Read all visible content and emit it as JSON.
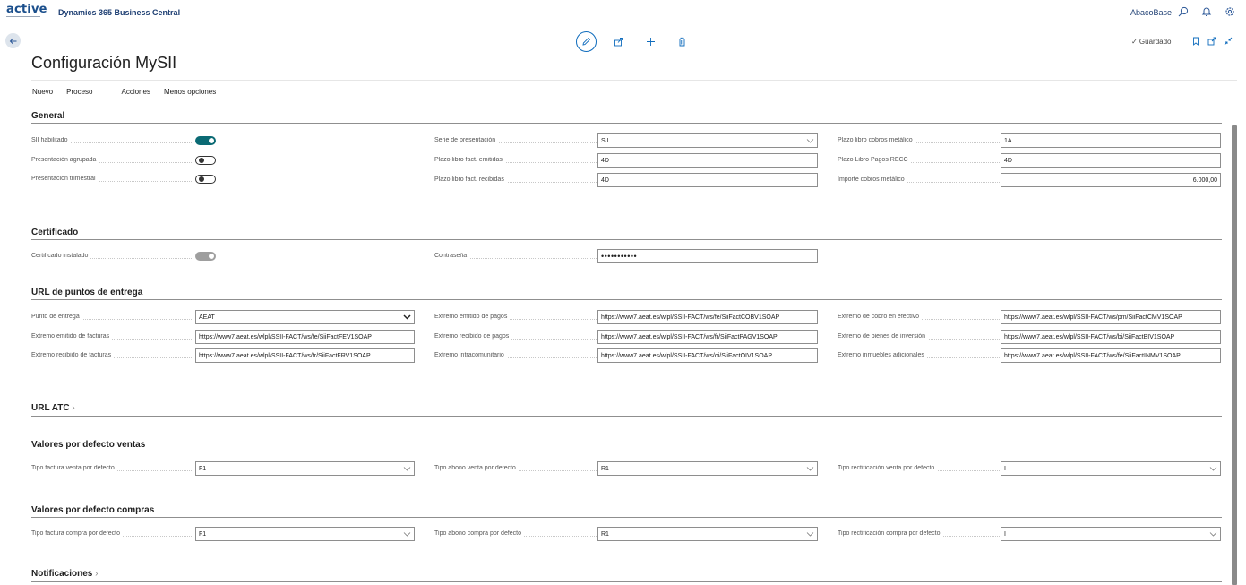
{
  "app": {
    "logo": "active",
    "product": "Dynamics 365 Business Central",
    "company": "AbacoBase"
  },
  "header": {
    "saved_label": "✓ Guardado",
    "title": "Configuración MySII"
  },
  "menu": {
    "items": [
      "Nuevo",
      "Proceso",
      "Acciones",
      "Menos opciones"
    ]
  },
  "sections": {
    "general": "General",
    "certificado": "Certificado",
    "url_puntos": "URL de puntos de entrega",
    "url_atc": "URL ATC",
    "defecto_ventas": "Valores por defecto ventas",
    "defecto_compras": "Valores por defecto compras",
    "notificaciones": "Notificaciones"
  },
  "general": {
    "sii_habilitado": {
      "label": "SII habilitado",
      "on": true
    },
    "presentacion_agrupada": {
      "label": "Presentación agrupada",
      "on": false
    },
    "presentacion_trimestral": {
      "label": "Presentacion trimestral",
      "on": false
    },
    "serie_presentacion": {
      "label": "Serie de presentación",
      "value": "SII"
    },
    "plazo_emitidas": {
      "label": "Plazo libro fact. emitidas",
      "value": "4D"
    },
    "plazo_recibidas": {
      "label": "Plazo libro fact. recibidas",
      "value": "4D"
    },
    "plazo_cobros_metalico": {
      "label": "Plazo libro cobros metálico",
      "value": "1A"
    },
    "plazo_pagos_recc": {
      "label": "Plazo Libro Pagos RECC",
      "value": "4D"
    },
    "importe_cobros_metalico": {
      "label": "Importe cobros metálico",
      "value": "6.000,00"
    }
  },
  "certificado": {
    "instalado": {
      "label": "Certificado instalado",
      "on": true
    },
    "contrasena": {
      "label": "Contraseña",
      "value": "•••••••••••"
    }
  },
  "urls": {
    "punto_entrega": {
      "label": "Punto de entrega",
      "value": "AEAT"
    },
    "emitido_facturas": {
      "label": "Extremo emitido de facturas",
      "value": "https://www7.aeat.es/wlpl/SSII-FACT/ws/fe/SiiFactFEV1SOAP"
    },
    "recibido_facturas": {
      "label": "Extremo recibido de facturas",
      "value": "https://www7.aeat.es/wlpl/SSII-FACT/ws/fr/SiiFactFRV1SOAP"
    },
    "emitido_pagos": {
      "label": "Extremo emitido de pagos",
      "value": "https://www7.aeat.es/wlpl/SSII-FACT/ws/fe/SiiFactCOBV1SOAP"
    },
    "recibido_pagos": {
      "label": "Extremo recibido de pagos",
      "value": "https://www7.aeat.es/wlpl/SSII-FACT/ws/fr/SiiFactPAGV1SOAP"
    },
    "intracomunitario": {
      "label": "Extremo intracomunitario",
      "value": "https://www7.aeat.es/wlpl/SSII-FACT/ws/oi/SiiFactOIV1SOAP"
    },
    "cobro_efectivo": {
      "label": "Extremo de cobro en efectivo",
      "value": "https://www7.aeat.es/wlpl/SSII-FACT/ws/pm/SiiFactCMV1SOAP"
    },
    "bienes_inversion": {
      "label": "Extremo de bienes de inversión",
      "value": "https://www7.aeat.es/wlpl/SSII-FACT/ws/bi/SiiFactBIV1SOAP"
    },
    "inmuebles_adicionales": {
      "label": "Extremo inmuebles adicionales",
      "value": "https://www7.aeat.es/wlpl/SSII-FACT/ws/fe/SiiFactINMV1SOAP"
    }
  },
  "ventas": {
    "tipo_factura": {
      "label": "Tipo factura venta por defecto",
      "value": "F1"
    },
    "tipo_abono": {
      "label": "Tipo abono venta por defecto",
      "value": "R1"
    },
    "tipo_rectificacion": {
      "label": "Tipo rectificación venta por defecto",
      "value": "I"
    }
  },
  "compras": {
    "tipo_factura": {
      "label": "Tipo factura compra por defecto",
      "value": "F1"
    },
    "tipo_abono": {
      "label": "Tipo abono compra por defecto",
      "value": "R1"
    },
    "tipo_rectificacion": {
      "label": "Tipo rectificación compra por defecto",
      "value": "I"
    }
  },
  "colors": {
    "accent": "#0b6a74",
    "brand": "#1e3f73",
    "action": "#0f6cbd"
  }
}
